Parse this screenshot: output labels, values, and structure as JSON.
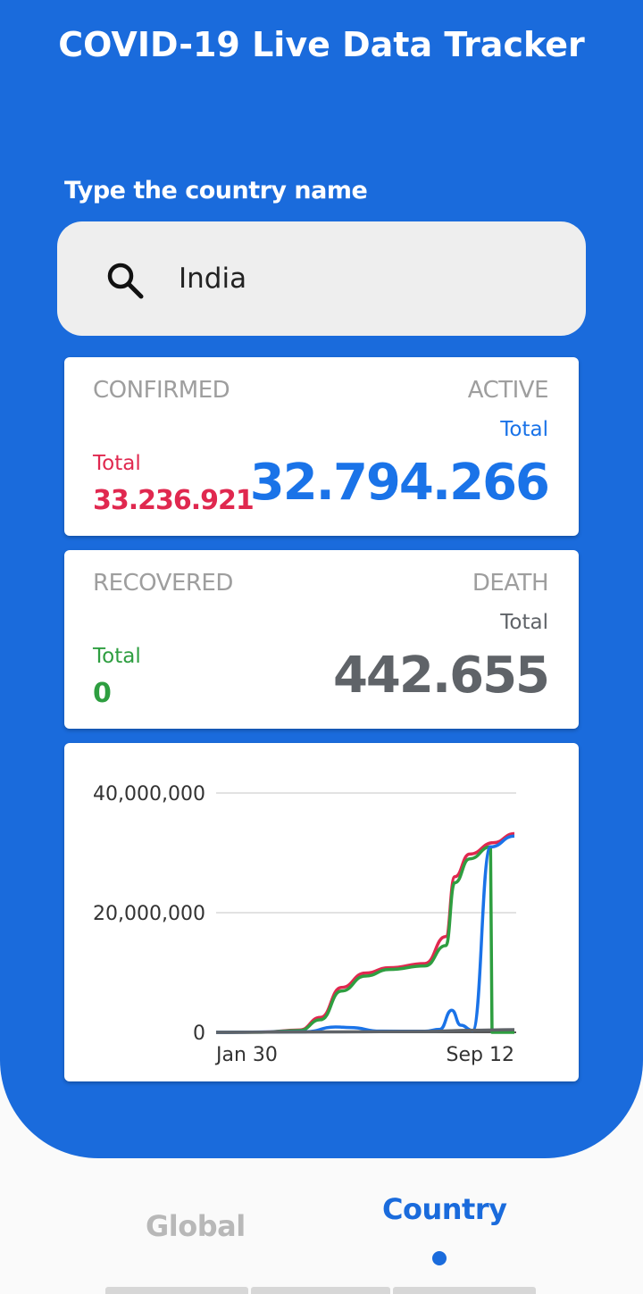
{
  "app": {
    "title": "COVID-19 Live Data Tracker"
  },
  "search": {
    "label": "Type the country name",
    "value": "India",
    "icon": "search-icon"
  },
  "cards": {
    "confirmed": {
      "heading": "CONFIRMED",
      "total_label": "Total",
      "value": "33.236.921",
      "color": "#e0284f"
    },
    "active": {
      "heading": "ACTIVE",
      "total_label": "Total",
      "value": "32.794.266",
      "color": "#1a73e8"
    },
    "recovered": {
      "heading": "RECOVERED",
      "total_label": "Total",
      "value": "0",
      "color": "#2e9e40"
    },
    "death": {
      "heading": "DEATH",
      "total_label": "Total",
      "value": "442.655",
      "color": "#5f6368"
    }
  },
  "chart_data": {
    "type": "line",
    "x_ticks": [
      "Jan 30",
      "Sep 12"
    ],
    "y_ticks": [
      "40,000,000",
      "20,000,000",
      "0"
    ],
    "ylim": [
      0,
      40000000
    ],
    "grid": true,
    "series": [
      {
        "color": "#e0284f",
        "values": [
          [
            0,
            0
          ],
          [
            0.15,
            30000
          ],
          [
            0.28,
            400000
          ],
          [
            0.35,
            2500000
          ],
          [
            0.42,
            7500000
          ],
          [
            0.5,
            9900000
          ],
          [
            0.58,
            10800000
          ],
          [
            0.7,
            11500000
          ],
          [
            0.77,
            16000000
          ],
          [
            0.8,
            26000000
          ],
          [
            0.85,
            29800000
          ],
          [
            0.93,
            31700000
          ],
          [
            1,
            33200000
          ]
        ]
      },
      {
        "color": "#2e9e40",
        "values": [
          [
            0,
            0
          ],
          [
            0.15,
            20000
          ],
          [
            0.28,
            300000
          ],
          [
            0.35,
            2100000
          ],
          [
            0.42,
            6900000
          ],
          [
            0.5,
            9400000
          ],
          [
            0.58,
            10500000
          ],
          [
            0.7,
            11100000
          ],
          [
            0.77,
            14500000
          ],
          [
            0.8,
            25000000
          ],
          [
            0.85,
            29000000
          ],
          [
            0.92,
            31000000
          ],
          [
            0.925,
            0
          ],
          [
            1,
            0
          ]
        ]
      },
      {
        "color": "#1a73e8",
        "values": [
          [
            0,
            0
          ],
          [
            0.3,
            100000
          ],
          [
            0.4,
            900000
          ],
          [
            0.45,
            800000
          ],
          [
            0.55,
            200000
          ],
          [
            0.7,
            180000
          ],
          [
            0.75,
            500000
          ],
          [
            0.79,
            3700000
          ],
          [
            0.82,
            1200000
          ],
          [
            0.86,
            300000
          ],
          [
            0.92,
            31000000
          ],
          [
            1,
            32800000
          ]
        ]
      },
      {
        "color": "#5f6368",
        "values": [
          [
            0,
            0
          ],
          [
            0.5,
            100000
          ],
          [
            0.7,
            150000
          ],
          [
            0.85,
            330000
          ],
          [
            1,
            442655
          ]
        ]
      }
    ]
  },
  "nav": {
    "tabs": [
      {
        "label": "Global",
        "active": false
      },
      {
        "label": "Country",
        "active": true
      }
    ]
  }
}
